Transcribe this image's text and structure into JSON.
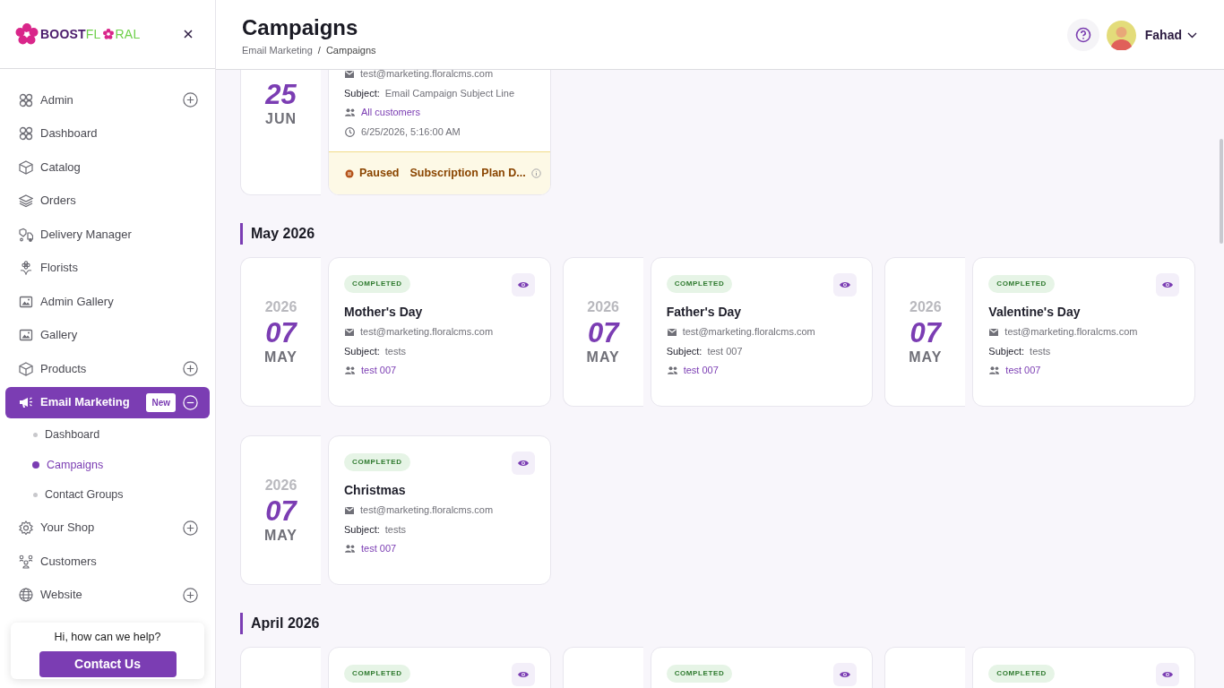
{
  "brand": {
    "part_1": "BOOST",
    "part_2": "FL",
    "part_3": "RAL"
  },
  "sidebar": {
    "items": [
      {
        "label": "Admin",
        "expanded": false,
        "selected": false
      },
      {
        "label": "Dashboard",
        "selected": false
      },
      {
        "label": "Catalog",
        "selected": false
      },
      {
        "label": "Orders",
        "selected": false
      },
      {
        "label": "Delivery Manager",
        "selected": false
      },
      {
        "label": "Florists",
        "selected": false
      },
      {
        "label": "Admin Gallery",
        "selected": false
      },
      {
        "label": "Gallery",
        "selected": false
      },
      {
        "label": "Products",
        "expanded": false,
        "selected": false
      },
      {
        "label": "Email Marketing",
        "expanded": true,
        "selected": true,
        "badge": "New",
        "children": [
          {
            "label": "Dashboard",
            "selected": false
          },
          {
            "label": "Campaigns",
            "selected": true
          },
          {
            "label": "Contact Groups",
            "selected": false
          }
        ]
      },
      {
        "label": "Your Shop",
        "expanded": false,
        "selected": false
      },
      {
        "label": "Customers",
        "selected": false
      },
      {
        "label": "Website",
        "expanded": false,
        "selected": false
      }
    ],
    "help": {
      "text": "Hi, how can we help?",
      "button": "Contact Us"
    }
  },
  "header": {
    "title": "Campaigns",
    "breadcrumb": [
      "Email Marketing",
      "Campaigns"
    ],
    "breadcrumb_separator": "/",
    "user": "Fahad"
  },
  "sections": [
    {
      "campaigns": [
        {
          "day": "25",
          "month": "JUN",
          "email": "test@marketing.floralcms.com",
          "subject_label": "Subject:",
          "subject": "Email Campaign Subject Line",
          "audience": "All customers",
          "datetime": "6/25/2026, 5:16:00 AM",
          "footer": {
            "state": "Paused",
            "text": "Subscription Plan D..."
          }
        }
      ]
    },
    {
      "heading": "May 2026",
      "campaigns": [
        {
          "year": "2026",
          "day": "07",
          "month": "MAY",
          "badge": "COMPLETED",
          "name": "Mother's Day",
          "email": "test@marketing.floralcms.com",
          "subject_label": "Subject:",
          "subject": "tests",
          "audience": "test 007"
        },
        {
          "year": "2026",
          "day": "07",
          "month": "MAY",
          "badge": "COMPLETED",
          "name": "Father's Day",
          "email": "test@marketing.floralcms.com",
          "subject_label": "Subject:",
          "subject": "test 007",
          "audience": "test 007"
        },
        {
          "year": "2026",
          "day": "07",
          "month": "MAY",
          "badge": "COMPLETED",
          "name": "Valentine's Day",
          "email": "test@marketing.floralcms.com",
          "subject_label": "Subject:",
          "subject": "tests",
          "audience": "test 007"
        },
        {
          "year": "2026",
          "day": "07",
          "month": "MAY",
          "badge": "COMPLETED",
          "name": "Christmas",
          "email": "test@marketing.floralcms.com",
          "subject_label": "Subject:",
          "subject": "tests",
          "audience": "test 007"
        }
      ]
    },
    {
      "heading": "April 2026",
      "campaigns": [
        {
          "badge": "COMPLETED"
        },
        {
          "badge": "COMPLETED"
        },
        {
          "badge": "COMPLETED"
        }
      ]
    }
  ]
}
